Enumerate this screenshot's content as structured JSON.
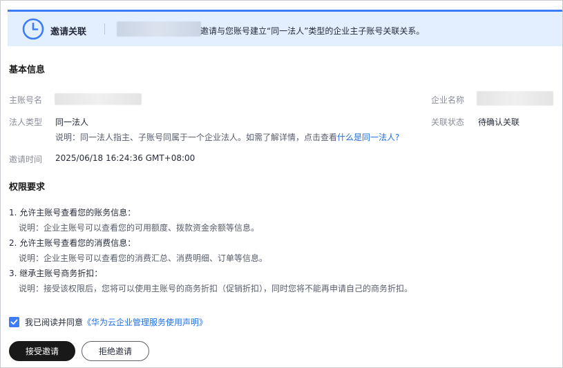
{
  "banner": {
    "title": "邀请关联",
    "message": "邀请与您账号建立“同一法人”类型的企业主子账号关联关系。"
  },
  "basic_info": {
    "title": "基本信息",
    "main_account_label": "主账号名",
    "company_name_label": "企业名称",
    "legal_type_label": "法人类型",
    "legal_type_value": "同一法人",
    "status_label": "关联状态",
    "status_value": "待确认关联",
    "note_prefix": "说明：同一法人指主、子账号同属于一个企业法人。如需了解详情，点击查看",
    "note_link": "什么是同一法人?",
    "invite_time_label": "邀请时间",
    "invite_time_value": "2025/06/18 16:24:36 GMT+08:00"
  },
  "permissions": {
    "title": "权限要求",
    "items": [
      {
        "title": "1. 允许主账号查看您的账务信息：",
        "desc": "说明：企业主账号可以查看您的可用额度、拨款资金余额等信息。"
      },
      {
        "title": "2. 允许主账号查看您的消费信息：",
        "desc": "说明：企业主账号可以查看您的消费汇总、消费明细、订单等信息。"
      },
      {
        "title": "3. 继承主账号商务折扣：",
        "desc": "说明：接受该权限后，您将可以使用主账号的商务折扣（促销折扣），同时您将不能再申请自己的商务折扣。"
      }
    ]
  },
  "agreement": {
    "checked": true,
    "prefix": "我已阅读并同意",
    "link": "《华为云企业管理服务使用声明》"
  },
  "actions": {
    "accept_label": "接受邀请",
    "reject_label": "拒绝邀请"
  },
  "colors": {
    "accent": "#3c7cf7",
    "link": "#2070e4",
    "banner_bg": "#e3eefe",
    "primary_button": "#191919"
  }
}
